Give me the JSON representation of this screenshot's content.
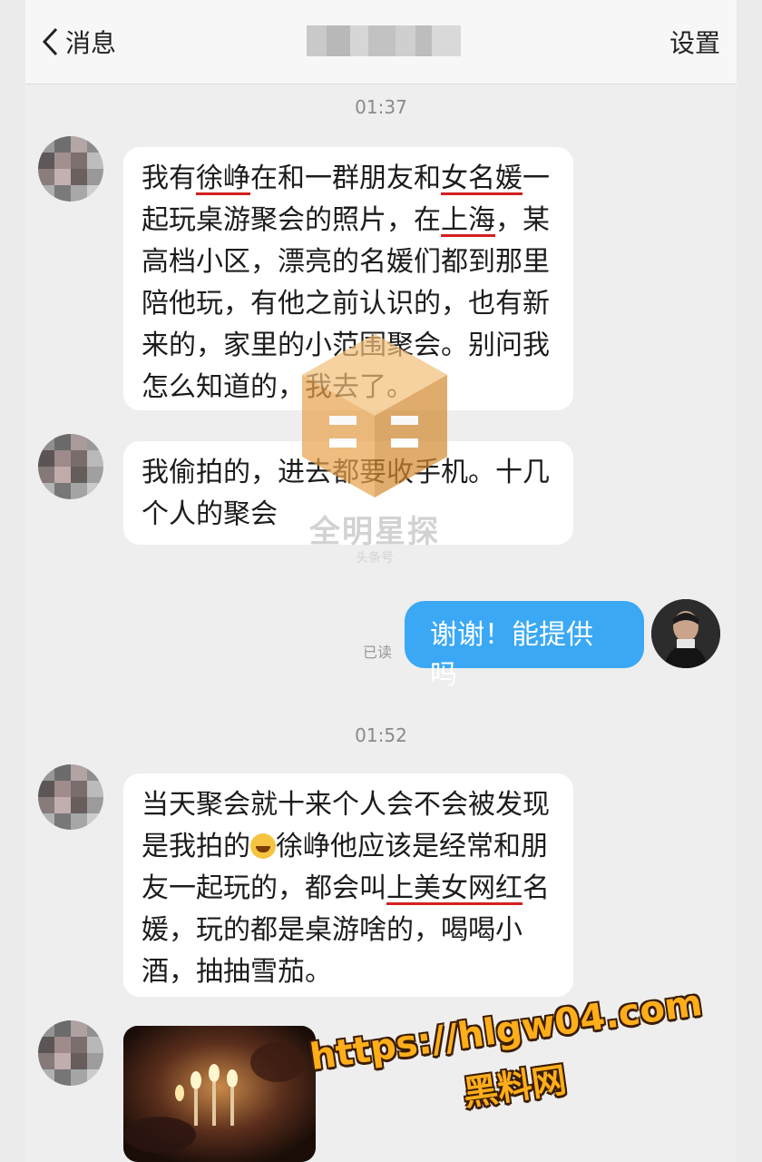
{
  "header": {
    "back_label": "消息",
    "settings_label": "设置"
  },
  "timestamps": [
    "01:37",
    "01:52"
  ],
  "messages": {
    "m1": {
      "a1": "我有",
      "b1": "徐峥",
      "a2": "在和一群朋友和",
      "b2": "女名媛",
      "a3": "一起玩桌游聚会的照片，在",
      "b3": "上海",
      "a4": "，某高档小区，漂亮的名媛们都到那里陪他玩，有他之前认识的，也有新来的，家里的小范围聚会。别问我怎么知道的，我去了。"
    },
    "m2": "我偷拍的，进去都要收手机。十几个人的聚会",
    "m3": "谢谢！能提供吗",
    "m3_status": "已读",
    "m4": {
      "a1": "当天聚会就十来个人会不会被发现是我拍的",
      "emoji": "face-with-tears-of-joy",
      "a2": "徐峥他应该是经常和朋友一起玩的，都会叫",
      "b1": "上美女网红",
      "a3": "名媛，玩的都是桌游啥的，喝喝小酒，抽抽雪茄。"
    }
  },
  "watermark": {
    "name": "全明星探",
    "sub": "头条号"
  },
  "overlay": {
    "url": "https://hlgw04.com",
    "site": "黑料网"
  },
  "colors": {
    "accent_blue": "#3aa8f5",
    "underline_red": "#d42020",
    "overlay_orange": "#ffae1a"
  }
}
